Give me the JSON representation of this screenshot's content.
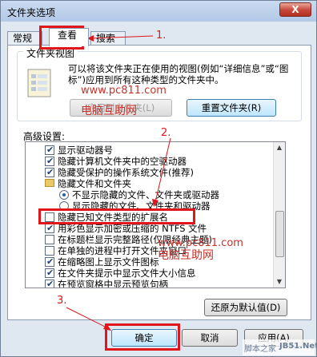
{
  "window": {
    "title": "文件夹选项",
    "close_label": "X"
  },
  "tabs": [
    {
      "label": "常规"
    },
    {
      "label": "查看"
    },
    {
      "label": "搜索"
    }
  ],
  "folder_views": {
    "group_label": "文件夹视图",
    "description": "可以将该文件夹正在使用的视图(例如“详细信息”或“图标”)应用到所有这种类型的文件夹中。",
    "apply_button": "应用到文件夹(L)",
    "reset_button": "重置文件夹(R)"
  },
  "advanced": {
    "label": "高级设置:",
    "items": [
      {
        "type": "checkbox",
        "checked": true,
        "label": "显示驱动器号"
      },
      {
        "type": "checkbox",
        "checked": true,
        "label": "隐藏计算机文件夹中的空驱动器"
      },
      {
        "type": "checkbox",
        "checked": true,
        "label": "隐藏受保护的操作系统文件(推荐)"
      },
      {
        "type": "folder",
        "label": "隐藏文件和文件夹"
      },
      {
        "type": "radio",
        "checked": true,
        "label": "不显示隐藏的文件、文件夹或驱动器"
      },
      {
        "type": "radio",
        "checked": false,
        "label": "显示隐藏的文件、文件夹和驱动器"
      },
      {
        "type": "checkbox",
        "checked": false,
        "label": "隐藏已知文件类型的扩展名"
      },
      {
        "type": "checkbox",
        "checked": true,
        "label": "用彩色显示加密或压缩的 NTFS 文件"
      },
      {
        "type": "checkbox",
        "checked": false,
        "label": "在标题栏显示完整路径(仅限经典主题)"
      },
      {
        "type": "checkbox",
        "checked": false,
        "label": "在单独的进程中打开文件夹窗口"
      },
      {
        "type": "checkbox",
        "checked": true,
        "label": "在缩略图上显示文件图标"
      },
      {
        "type": "checkbox",
        "checked": true,
        "label": "在文件夹提示中显示文件大小信息"
      },
      {
        "type": "checkbox",
        "checked": true,
        "label": "在预览窗格中显示预览句柄"
      }
    ],
    "restore_button": "还原为默认值(D)"
  },
  "footer": {
    "ok": "确定",
    "cancel": "取消",
    "apply": "应用(A)"
  },
  "annotations": {
    "step1": "1.",
    "step2": "2.",
    "step3": "3.",
    "red_color": "#e0161a"
  },
  "watermarks": {
    "site1": "www.pc811.com",
    "brand1": "电脑互助网",
    "site2": "www.pc811.com",
    "brand2": "电脑互助网",
    "corner_site": "脚本之家",
    "corner_domain": "JB51.Net"
  }
}
